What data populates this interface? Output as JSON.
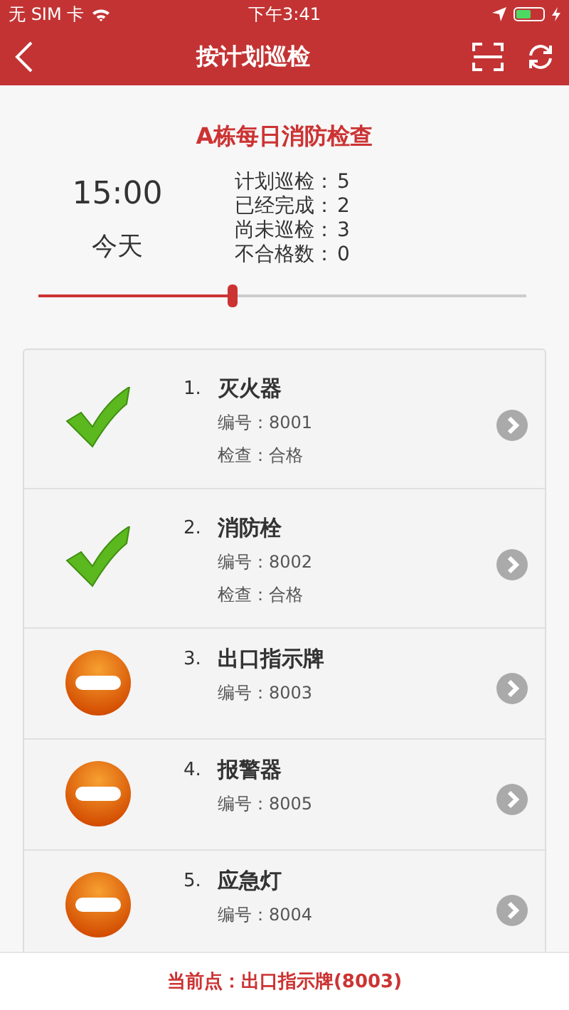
{
  "status_bar": {
    "carrier": "无 SIM 卡",
    "time": "下午3:41"
  },
  "nav": {
    "title": "按计划巡检"
  },
  "plan": {
    "title": "A栋每日消防检查",
    "time": "15:00",
    "day": "今天",
    "stats": [
      {
        "label": "计划巡检：",
        "value": "5"
      },
      {
        "label": "已经完成：",
        "value": "2"
      },
      {
        "label": "尚未巡检：",
        "value": "3"
      },
      {
        "label": "不合格数：",
        "value": "0"
      }
    ],
    "level": 0.39
  },
  "items": [
    {
      "index": "1.",
      "name": "灭火器",
      "code": "编号：8001",
      "check": "检查：合格",
      "kind": "passed"
    },
    {
      "index": "2.",
      "name": "消防栓",
      "code": "编号：8002",
      "check": "检查：合格",
      "kind": "passed"
    },
    {
      "index": "3.",
      "name": "出口指示牌",
      "code": "编号：8003",
      "kind": "pending"
    },
    {
      "index": "4.",
      "name": "报警器",
      "code": "编号：8005",
      "kind": "pending"
    },
    {
      "index": "5.",
      "name": "应急灯",
      "code": "编号：8004",
      "kind": "pending"
    }
  ],
  "current": {
    "text": "当前点：出口指示牌(8003)"
  }
}
